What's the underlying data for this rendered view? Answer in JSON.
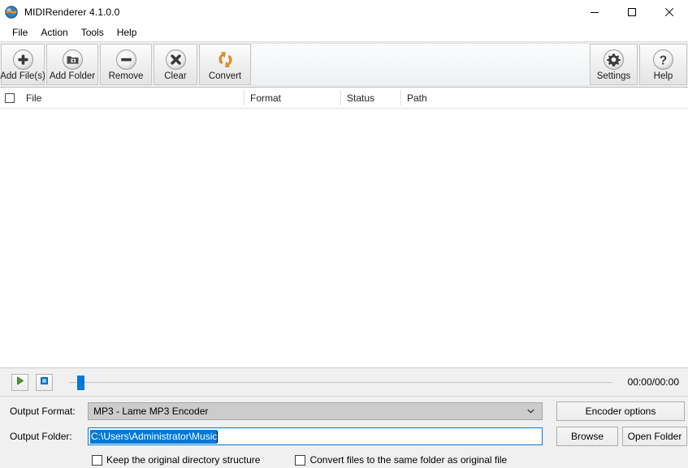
{
  "window": {
    "title": "MIDIRenderer 4.1.0.0",
    "app_icon": "globe-icon",
    "minimize_label": "Minimize",
    "maximize_label": "Maximize",
    "close_label": "Close"
  },
  "menubar": {
    "items": [
      {
        "label": "File"
      },
      {
        "label": "Action"
      },
      {
        "label": "Tools"
      },
      {
        "label": "Help"
      }
    ]
  },
  "toolbar": {
    "left_buttons": [
      {
        "label": "Add File(s)",
        "icon": "plus-circle-icon"
      },
      {
        "label": "Add Folder",
        "icon": "folder-add-icon"
      },
      {
        "label": "Remove",
        "icon": "minus-circle-icon"
      },
      {
        "label": "Clear",
        "icon": "cross-circle-icon"
      },
      {
        "label": "Convert",
        "icon": "convert-arrows-icon"
      }
    ],
    "right_buttons": [
      {
        "label": "Settings",
        "icon": "gear-icon"
      },
      {
        "label": "Help",
        "icon": "question-mark-icon"
      }
    ]
  },
  "file_list": {
    "select_all_checked": false,
    "columns": [
      {
        "label": "File"
      },
      {
        "label": "Format"
      },
      {
        "label": "Status"
      },
      {
        "label": "Path"
      }
    ],
    "rows": []
  },
  "player": {
    "play_label": "Play",
    "stop_label": "Stop",
    "play_icon": "play-triangle-icon",
    "stop_icon": "stop-square-icon",
    "position_percent": 0,
    "time": "00:00/00:00"
  },
  "output": {
    "format_label": "Output Format:",
    "format_value": "MP3 - Lame MP3 Encoder",
    "encoder_options_label": "Encoder options",
    "folder_label": "Output Folder:",
    "folder_value": "C:\\Users\\Administrator\\Music",
    "folder_selected": true,
    "browse_label": "Browse",
    "open_folder_label": "Open Folder",
    "keep_structure_label": "Keep the original directory structure",
    "keep_structure_checked": false,
    "same_folder_label": "Convert files to the same folder as original file",
    "same_folder_checked": false
  },
  "colors": {
    "accent": "#0078d7",
    "convert_icon": "#e8901f",
    "play_icon": "#4aa02c",
    "stop_icon": "#0a7fd6",
    "window_bg": "#f0f0f0"
  }
}
